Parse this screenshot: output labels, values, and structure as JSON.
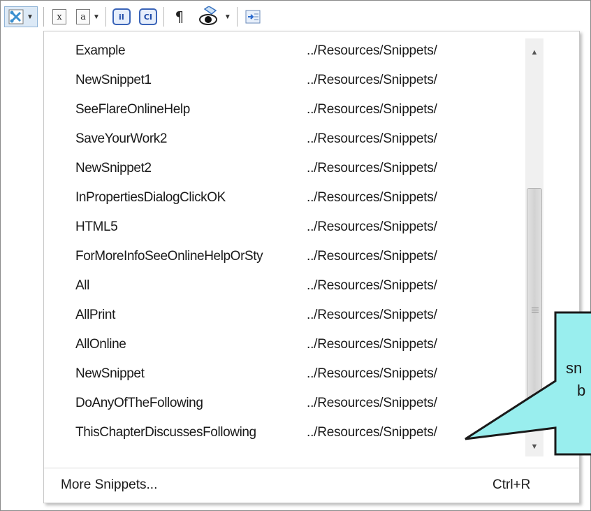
{
  "toolbar": {
    "buttons": [
      {
        "name": "snippet-icon",
        "glyph": "✂"
      },
      {
        "name": "variable-icon",
        "glyph": "x"
      },
      {
        "name": "text-format-icon",
        "glyph": "a"
      },
      {
        "name": "insert-index-icon",
        "glyph": "iI"
      },
      {
        "name": "insert-concept-icon",
        "glyph": "CI"
      },
      {
        "name": "show-marks-icon",
        "glyph": "¶"
      },
      {
        "name": "preview-eye-icon",
        "glyph": "◉"
      },
      {
        "name": "insert-link-icon",
        "glyph": "⇒"
      }
    ]
  },
  "snippets": [
    {
      "name": "Example",
      "path": "../Resources/Snippets/"
    },
    {
      "name": "NewSnippet1",
      "path": "../Resources/Snippets/"
    },
    {
      "name": "SeeFlareOnlineHelp",
      "path": "../Resources/Snippets/"
    },
    {
      "name": "SaveYourWork2",
      "path": "../Resources/Snippets/"
    },
    {
      "name": "NewSnippet2",
      "path": "../Resources/Snippets/"
    },
    {
      "name": "InPropertiesDialogClickOK",
      "path": "../Resources/Snippets/"
    },
    {
      "name": "HTML5",
      "path": "../Resources/Snippets/"
    },
    {
      "name": "ForMoreInfoSeeOnlineHelpOrSty",
      "path": "../Resources/Snippets/"
    },
    {
      "name": "All",
      "path": "../Resources/Snippets/"
    },
    {
      "name": "AllPrint",
      "path": "../Resources/Snippets/"
    },
    {
      "name": "AllOnline",
      "path": "../Resources/Snippets/"
    },
    {
      "name": "NewSnippet",
      "path": "../Resources/Snippets/"
    },
    {
      "name": "DoAnyOfTheFollowing",
      "path": "../Resources/Snippets/"
    },
    {
      "name": "ThisChapterDiscussesFollowing",
      "path": "../Resources/Snippets/"
    }
  ],
  "footer": {
    "more_label": "More Snippets...",
    "shortcut": "Ctrl+R"
  },
  "callout": {
    "line1": "sn",
    "line2": "b",
    "fill": "#99eeee",
    "stroke": "#1a1a1a"
  }
}
